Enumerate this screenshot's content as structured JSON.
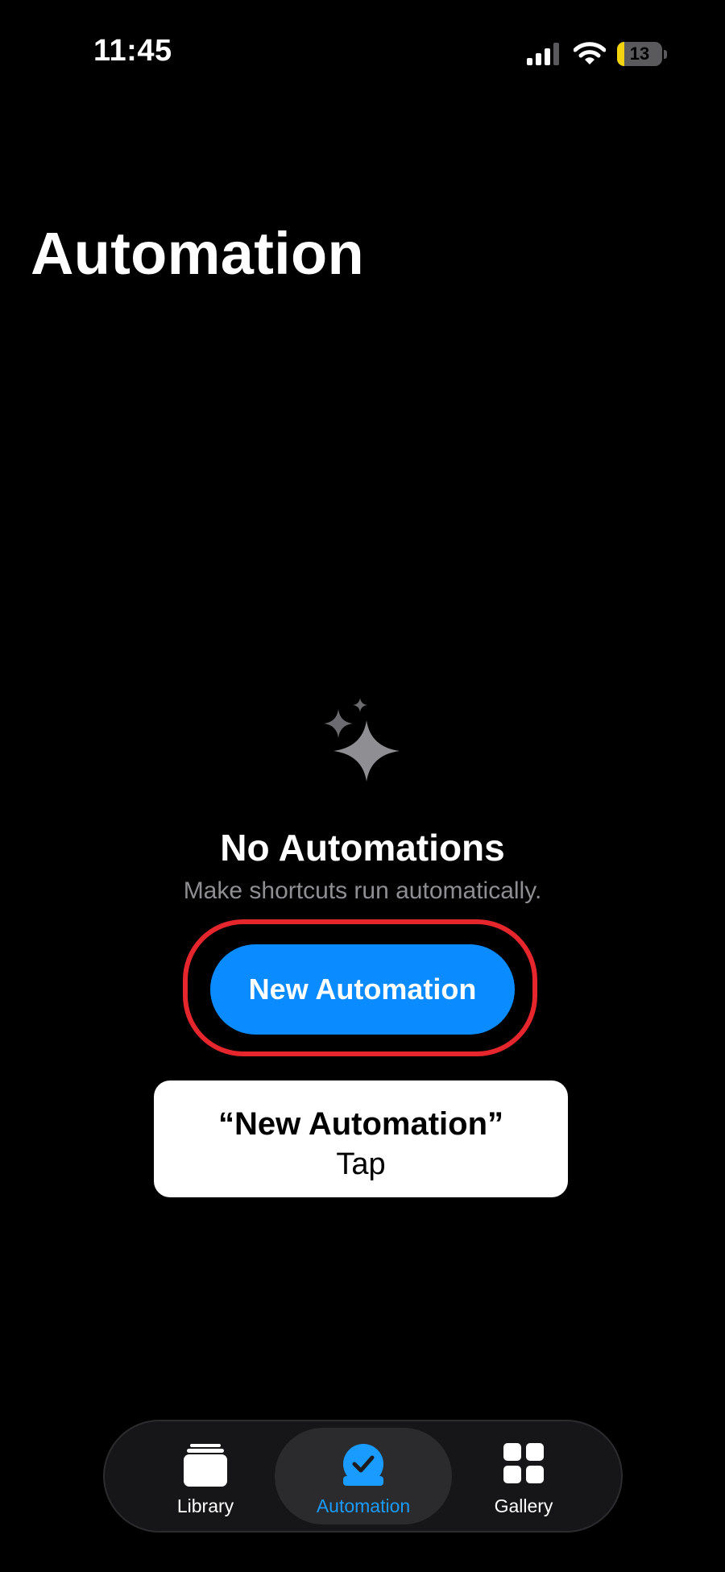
{
  "status_bar": {
    "time": "11:45",
    "battery_level": "13"
  },
  "page": {
    "title": "Automation"
  },
  "empty_state": {
    "icon": "sparkles-icon",
    "title": "No Automations",
    "subtitle": "Make shortcuts run automatically.",
    "button_label": "New Automation"
  },
  "tooltip": {
    "title": "“New Automation”",
    "action": "Tap"
  },
  "tab_bar": {
    "items": [
      {
        "label": "Library",
        "icon": "library-stack-icon",
        "selected": false
      },
      {
        "label": "Automation",
        "icon": "automation-clock-icon",
        "selected": true
      },
      {
        "label": "Gallery",
        "icon": "gallery-grid-icon",
        "selected": false
      }
    ]
  },
  "colors": {
    "accent": "#0a8bff",
    "highlight": "#e5262d",
    "battery": "#f4d30f",
    "background": "#000000"
  }
}
